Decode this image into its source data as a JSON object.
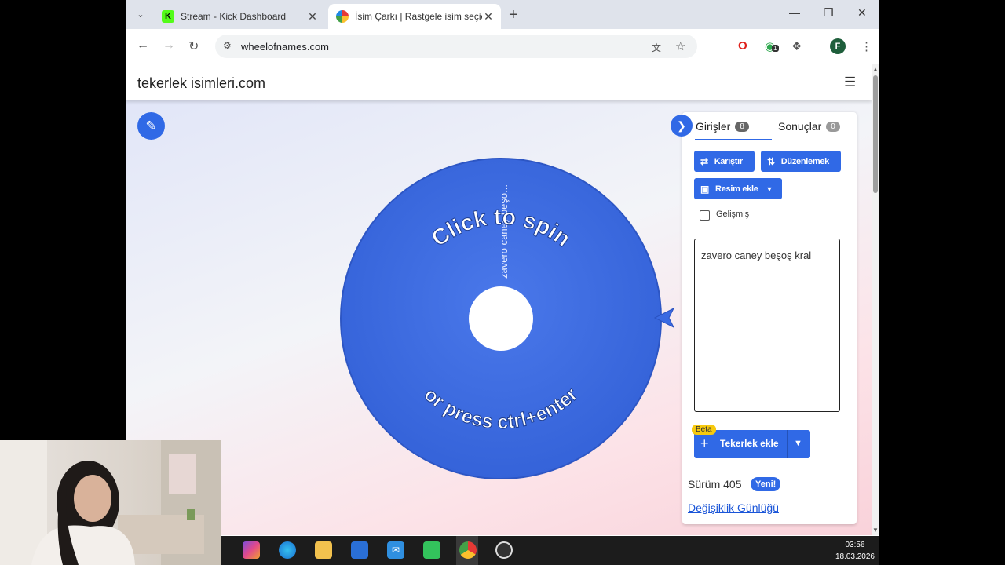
{
  "browser": {
    "tabs": [
      {
        "title": "Stream - Kick Dashboard",
        "active": false
      },
      {
        "title": "İsim Çarkı | Rastgele isim seçici",
        "active": true
      }
    ],
    "url": "wheelofnames.com",
    "profile_initial": "F",
    "extension_badge": "1"
  },
  "site": {
    "logo": "tekerlek isimleri.com"
  },
  "wheel": {
    "prompt_top": "Click to spin",
    "prompt_bottom": "or press ctrl+enter",
    "segment_label": "zavero caney beşo...",
    "color": "#3b6ae0"
  },
  "panel": {
    "tab_entries": "Girişler",
    "entries_count": "8",
    "tab_results": "Sonuçlar",
    "results_count": "0",
    "shuffle": "Karıştır",
    "sort": "Düzenlemek",
    "add_image": "Resim ekle",
    "advanced": "Gelişmiş",
    "entries_text": "zavero caney beşoş kral",
    "beta": "Beta",
    "add_wheel": "Tekerlek ekle",
    "version": "Sürüm 405",
    "new": "Yeni!",
    "changelog": "Değişiklik Günlüğü"
  },
  "taskbar": {
    "time": "03:56",
    "date": "18.03.2026"
  },
  "colors": {
    "accent": "#3069e6",
    "taskbar": "#1c1c1c"
  }
}
